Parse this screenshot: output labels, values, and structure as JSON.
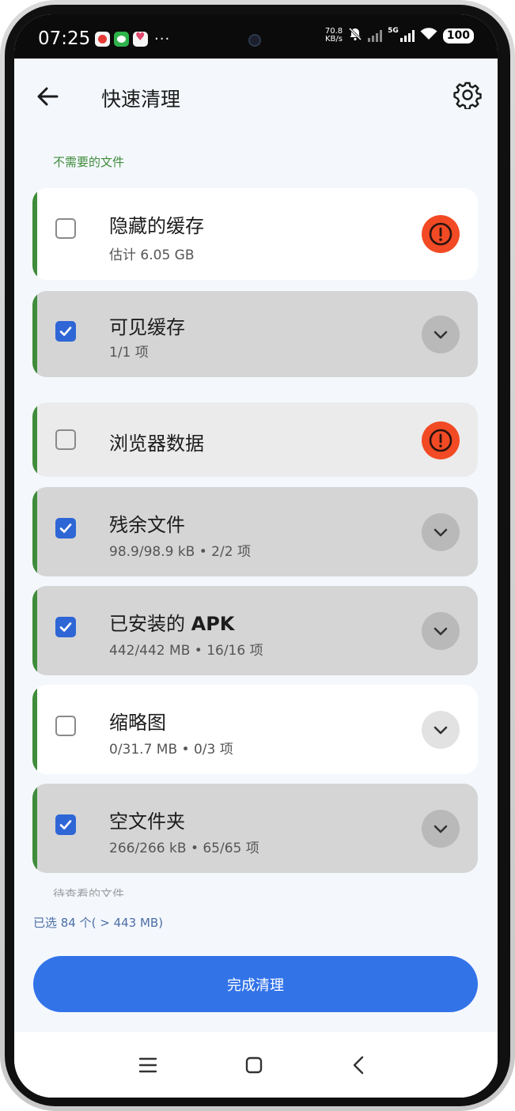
{
  "status_bar": {
    "time": "07:25",
    "more": "···",
    "net_speed_value": "70.8",
    "net_speed_unit": "KB/s",
    "network_type": "5G",
    "battery": "100"
  },
  "header": {
    "title": "快速清理",
    "back_icon": "arrow-left-icon",
    "settings_icon": "gear-icon"
  },
  "section_unneeded": "不需要的文件",
  "items": [
    {
      "title": "隐藏的缓存",
      "subtitle": "估计 6.05 GB",
      "checked": false,
      "action": "warning"
    },
    {
      "title": "可见缓存",
      "subtitle": "1/1 项",
      "checked": true,
      "action": "expand"
    },
    {
      "title": "浏览器数据",
      "subtitle": "",
      "checked": false,
      "action": "warning"
    },
    {
      "title": "残余文件",
      "subtitle": "98.9/98.9 kB • 2/2 项",
      "checked": true,
      "action": "expand"
    },
    {
      "title_prefix": "已安装的 ",
      "title_bold": "APK",
      "subtitle": "442/442 MB • 16/16 项",
      "checked": true,
      "action": "expand"
    },
    {
      "title": "缩略图",
      "subtitle": "0/31.7 MB • 0/3 项",
      "checked": false,
      "action": "expand"
    },
    {
      "title": "空文件夹",
      "subtitle": "266/266 kB • 65/65 项",
      "checked": true,
      "action": "expand"
    }
  ],
  "section_review": "待查看的文件",
  "selection_summary": "已选 84 个( > 443 MB)",
  "primary_button": "完成清理",
  "navigation": {
    "menu_icon": "menu-icon",
    "home_icon": "home-icon",
    "back_icon": "back-chevron-icon"
  },
  "colors": {
    "accent_green": "#3f8c3b",
    "checkbox_blue": "#2f66d6",
    "warning_red": "#f24a24",
    "primary_button": "#3273e8"
  }
}
